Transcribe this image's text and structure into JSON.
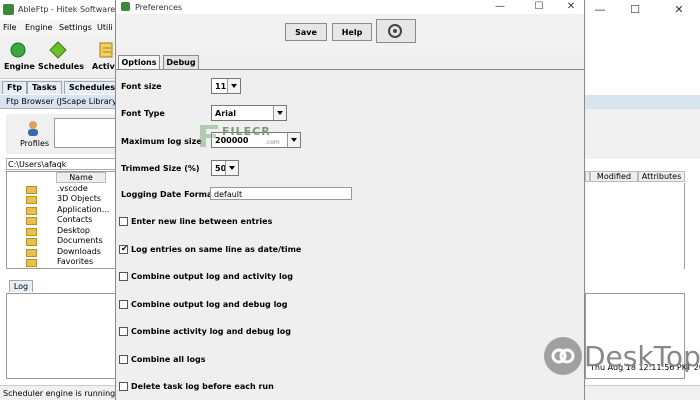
{
  "main_window": {
    "title": "AbleFtp - Hitek Software",
    "menu": [
      "File",
      "Engine",
      "Settings",
      "Utili"
    ],
    "toolbar": [
      {
        "label": "Engine",
        "icon": "engine-icon"
      },
      {
        "label": "Schedules",
        "icon": "schedules-icon"
      },
      {
        "label": "Activi",
        "icon": "activity-icon"
      }
    ],
    "tabs": [
      "Ftp",
      "Tasks",
      "Schedules"
    ],
    "ftp_browser_label": "Ftp Browser (JScape Library",
    "profiles_label": "Profiles",
    "path": "C:\\Users\\afaqk",
    "file_table": {
      "column_name": "Name",
      "files": [
        ".vscode",
        "3D Objects",
        "Application...",
        "Contacts",
        "Desktop",
        "Documents",
        "Downloads",
        "Favorites"
      ]
    },
    "right_columns": [
      "Modified",
      "Attributes"
    ],
    "log_tab": "Log",
    "status": "Scheduler engine is running.",
    "timestamp": "Thu Aug 18 12:11:56 PKT 2022",
    "controls": {
      "minimize": "—",
      "maximize": "☐",
      "close": "✕"
    }
  },
  "preferences": {
    "title": "Preferences",
    "buttons": {
      "save": "Save",
      "help": "Help"
    },
    "tabs": {
      "options": "Options",
      "debug": "Debug"
    },
    "fields": {
      "font_size": {
        "label": "Font size",
        "value": "11"
      },
      "font_type": {
        "label": "Font Type",
        "value": "Arial"
      },
      "max_log_size": {
        "label": "Maximum log size",
        "value": "200000"
      },
      "trimmed_size": {
        "label": "Trimmed Size (%)",
        "value": "50"
      },
      "logging_date_format": {
        "label": "Logging Date Format",
        "value": "default"
      }
    },
    "checkboxes": [
      {
        "label": "Enter new line between entries",
        "checked": false
      },
      {
        "label": "Log entries on same line as date/time",
        "checked": true
      },
      {
        "label": "Combine output log and activity log",
        "checked": false
      },
      {
        "label": "Combine output log and debug log",
        "checked": false
      },
      {
        "label": "Combine activity log and debug log",
        "checked": false
      },
      {
        "label": "Combine all logs",
        "checked": false
      },
      {
        "label": "Delete task log before each run",
        "checked": false
      }
    ],
    "check_mark": "✔",
    "controls": {
      "minimize": "—",
      "maximize": "☐",
      "close": "✕"
    }
  },
  "watermarks": {
    "filecr": "FILECR",
    "filecr_sub": ".com",
    "desktop": "DeskTop"
  }
}
